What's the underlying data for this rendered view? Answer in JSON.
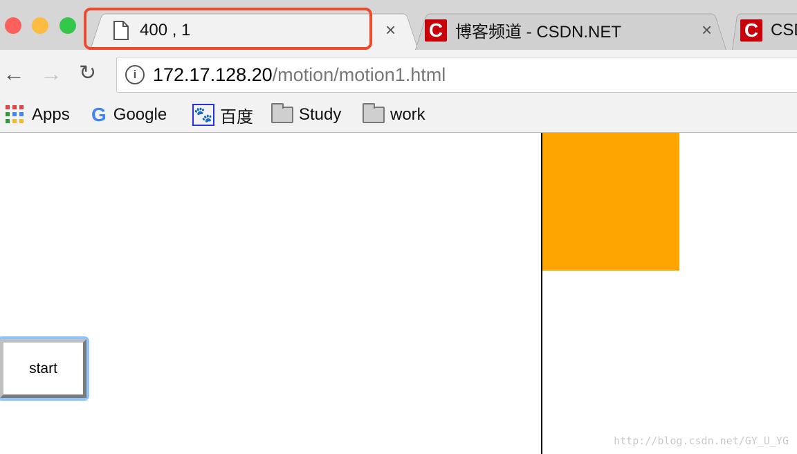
{
  "window": {
    "traffic_lights": {
      "close": "#fc605c",
      "minimize": "#fdbc40",
      "maximize": "#34c84a"
    }
  },
  "tabs": [
    {
      "title": "400 , 1",
      "icon": "page-icon",
      "active": true
    },
    {
      "title": "博客频道 - CSDN.NET",
      "icon": "csdn-icon",
      "active": false
    },
    {
      "title": "CSD",
      "icon": "csdn-icon",
      "active": false
    }
  ],
  "highlight_color": "#ef4a2c",
  "address": {
    "host": "172.17.128.20",
    "path": "/motion/motion1.html"
  },
  "bookmarks": [
    {
      "label": "Apps",
      "icon": "apps-grid-icon"
    },
    {
      "label": "Google",
      "icon": "google-icon"
    },
    {
      "label": "百度",
      "icon": "baidu-paw-icon"
    },
    {
      "label": "Study",
      "icon": "folder-icon"
    },
    {
      "label": "work",
      "icon": "folder-icon"
    }
  ],
  "page": {
    "box_color": "#ffa500",
    "start_button": "start"
  },
  "watermark": "http://blog.csdn.net/GY_U_YG"
}
